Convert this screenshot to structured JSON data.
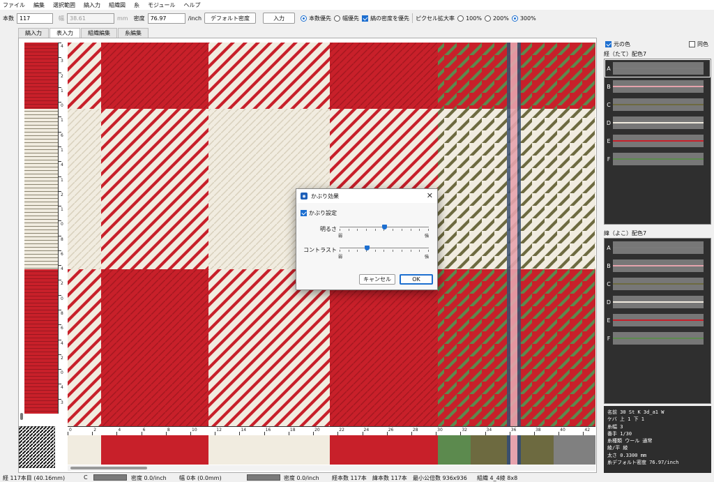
{
  "menu": [
    "ファイル",
    "編集",
    "選択範囲",
    "縞入力",
    "組織図",
    "糸",
    "モジュール",
    "ヘルプ"
  ],
  "toolbar": {
    "count_label": "本数",
    "count_value": "117",
    "width_label": "幅",
    "width_value": "38.61",
    "width_unit": "mm",
    "density_label": "密度",
    "density_value": "76.97",
    "density_unit": "/inch",
    "default_density_button": "デフォルト密度",
    "input_button": "入力",
    "priority_count": "本数優先",
    "priority_width": "幅優先",
    "warp_density_priority": "縞の密度を優先",
    "pixel_zoom_label": "ピクセル拡大率",
    "zoom_100": "100%",
    "zoom_200": "200%",
    "zoom_300": "300%"
  },
  "tabs": [
    "縞入力",
    "表入力",
    "組織編集",
    "糸編集"
  ],
  "colors": {
    "red": "#c8202a",
    "cream": "#f1ece0",
    "green": "#5c8a4e",
    "olive": "#6d6a40",
    "pink": "#e6a3ad",
    "navy": "#3a4f6e",
    "gray": "#808080",
    "accent": "#1d6fd0"
  },
  "vertical_ruler": [
    "4",
    "3",
    "2",
    "1",
    "0",
    "1",
    "6",
    "1",
    "4",
    "1",
    "2",
    "1",
    "0",
    "8",
    "6",
    "4",
    "2",
    "0",
    "8",
    "6",
    "4",
    "2",
    "0",
    "4",
    "3"
  ],
  "horizontal_ruler": [
    "0",
    "2",
    "4",
    "6",
    "8",
    "10",
    "12",
    "14",
    "16",
    "18",
    "20",
    "22",
    "24",
    "26",
    "28",
    "30",
    "32",
    "34",
    "36",
    "38",
    "40",
    "42"
  ],
  "right_panel": {
    "original_color_label": "元の色",
    "same_color_label": "同色",
    "warp_header": "経（たて）配色7",
    "weft_header": "緯（よこ）配色7",
    "warp_colors": [
      {
        "label": "A",
        "color": "#7a7a7a"
      },
      {
        "label": "B",
        "color": "#e6a3ad"
      },
      {
        "label": "C",
        "color": "#6d6a40"
      },
      {
        "label": "D",
        "color": "#f1ece0"
      },
      {
        "label": "E",
        "color": "#c8202a"
      },
      {
        "label": "F",
        "color": "#5c8a4e"
      }
    ],
    "weft_colors": [
      {
        "label": "A",
        "color": "#7a7a7a"
      },
      {
        "label": "B",
        "color": "#e6a3ad"
      },
      {
        "label": "C",
        "color": "#6d6a40"
      },
      {
        "label": "D",
        "color": "#f1ece0"
      },
      {
        "label": "E",
        "color": "#c8202a"
      },
      {
        "label": "F",
        "color": "#5c8a4e"
      }
    ],
    "yarn_info": [
      "名前  30 St K 3d_a1 W",
      "ケバ  上 1 下 1",
      "糸幅  3",
      "番手  1/30",
      "糸種類  ウール  通常",
      "綾/平  綾",
      "太さ  0.3300 mm",
      "糸デフォルト密度  76.97/inch"
    ]
  },
  "dialog": {
    "title": "かぶり効果",
    "enable_label": "かぶり設定",
    "brightness_label": "明るさ",
    "brightness_min": "弱",
    "brightness_max": "強",
    "brightness_value": 0.5,
    "contrast_label": "コントラスト",
    "contrast_min": "弱",
    "contrast_max": "強",
    "contrast_value": 0.31,
    "cancel_button": "キャンセル",
    "ok_button": "OK"
  },
  "status": {
    "warp_count": "経 117本目 (40.16mm)",
    "c_label": "C",
    "density1": "密度 0.0/inch",
    "width": "幅 0本 (0.0mm)",
    "density2": "密度 0.0/inch",
    "total_warp": "経本数 117本",
    "total_weft": "緯本数 117本",
    "min_common": "最小公倍数 936x936",
    "weave": "組織 4_4綾 8x8"
  }
}
